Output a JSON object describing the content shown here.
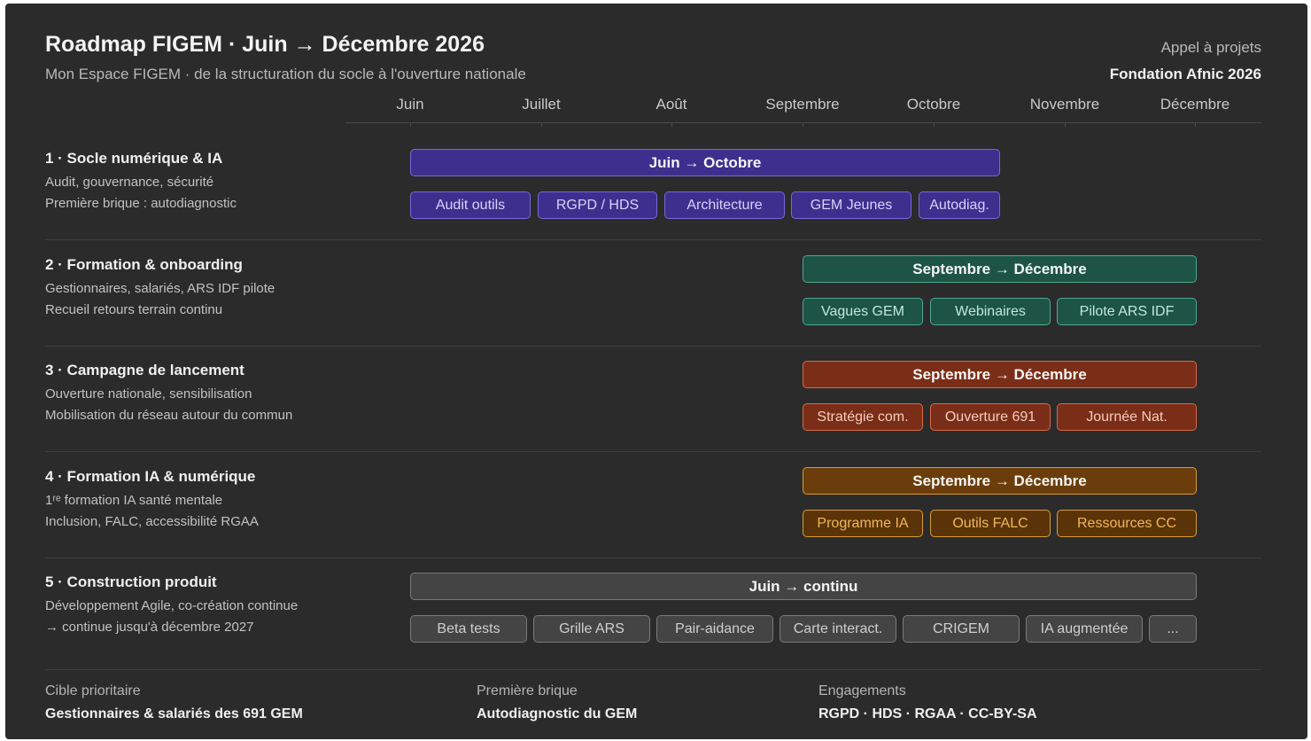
{
  "header": {
    "title": "Roadmap FIGEM · Juin → Décembre 2026",
    "subtitle": "Mon Espace FIGEM · de la structuration du socle à l'ouverture nationale",
    "call_label": "Appel à projets",
    "call_name": "Fondation Afnic 2026"
  },
  "months": [
    "Juin",
    "Juillet",
    "Août",
    "Septembre",
    "Octobre",
    "Novembre",
    "Décembre"
  ],
  "rows": [
    {
      "title": "1 · Socle numérique & IA",
      "line1": "Audit, gouvernance, sécurité",
      "line2": "Première brique : autodiagnostic",
      "bar": "Juin → Octobre",
      "chips": [
        "Audit outils",
        "RGPD / HDS",
        "Architecture",
        "GEM Jeunes",
        "Autodiag."
      ],
      "accent": "#3e2f8f"
    },
    {
      "title": "2 · Formation & onboarding",
      "line1": "Gestionnaires, salariés, ARS IDF pilote",
      "line2": "Recueil retours terrain continu",
      "bar": "Septembre → Décembre",
      "chips": [
        "Vagues GEM",
        "Webinaires",
        "Pilote ARS IDF"
      ],
      "accent": "#1d5446"
    },
    {
      "title": "3 · Campagne de lancement",
      "line1": "Ouverture nationale, sensibilisation",
      "line2": "Mobilisation du réseau autour du commun",
      "bar": "Septembre → Décembre",
      "chips": [
        "Stratégie com.",
        "Ouverture 691",
        "Journée Nat."
      ],
      "accent": "#7a2e18"
    },
    {
      "title": "4 · Formation IA & numérique",
      "line1": "1ʳᵉ formation IA santé mentale",
      "line2": "Inclusion, FALC, accessibilité RGAA",
      "bar": "Septembre → Décembre",
      "chips": [
        "Programme IA",
        "Outils FALC",
        "Ressources CC"
      ],
      "accent": "#6b3d0a"
    },
    {
      "title": "5 · Construction produit",
      "line1": "Développement Agile, co-création continue",
      "line2": "→ continue jusqu'à décembre 2027",
      "bar": "Juin → continu",
      "chips": [
        "Beta tests",
        "Grille ARS",
        "Pair-aidance",
        "Carte interact.",
        "CRIGEM",
        "IA augmentée",
        "..."
      ],
      "accent": "#444444"
    }
  ],
  "footer": [
    {
      "label": "Cible prioritaire",
      "value": "Gestionnaires & salariés des 691 GEM"
    },
    {
      "label": "Première brique",
      "value": "Autodiagnostic du GEM"
    },
    {
      "label": "Engagements",
      "value": "RGPD · HDS · RGAA · CC-BY-SA"
    }
  ]
}
